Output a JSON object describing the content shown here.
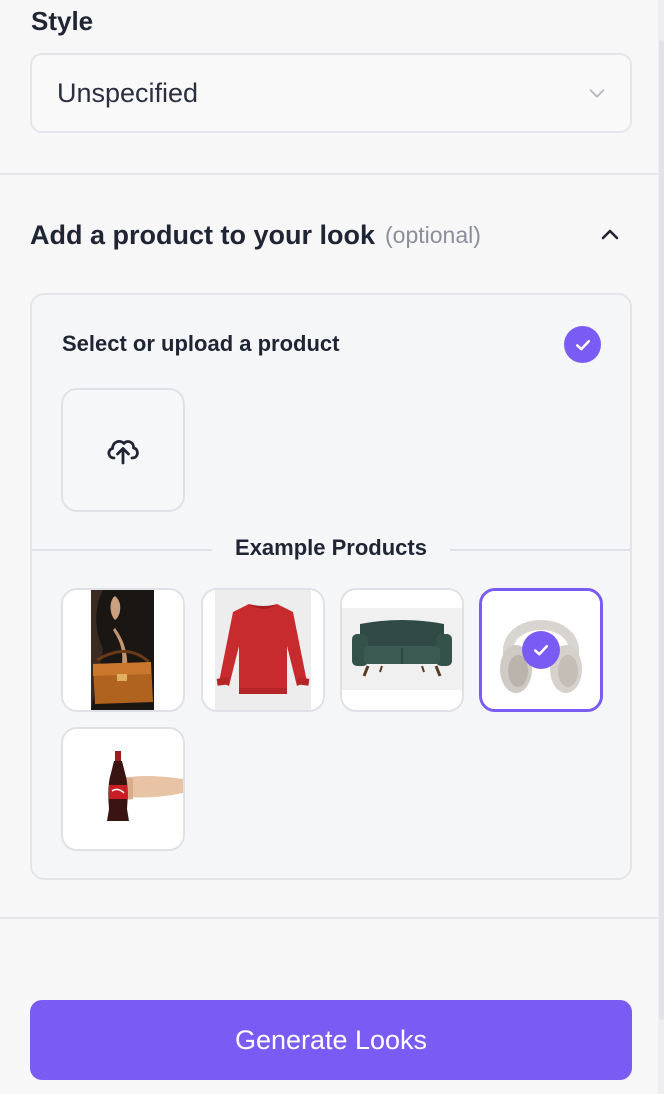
{
  "style": {
    "label": "Style",
    "selected_value": "Unspecified"
  },
  "product_section": {
    "title": "Add a product to your look",
    "optional_label": "(optional)",
    "expanded": true
  },
  "product_card": {
    "title": "Select or upload a product",
    "examples_label": "Example Products",
    "examples": [
      {
        "name": "handbag",
        "selected": false
      },
      {
        "name": "red-sweater",
        "selected": false
      },
      {
        "name": "green-sofa",
        "selected": false
      },
      {
        "name": "headphones",
        "selected": true
      },
      {
        "name": "coca-cola-bottle",
        "selected": false
      }
    ]
  },
  "generate_button": {
    "label": "Generate Looks"
  },
  "colors": {
    "accent": "#7a5cf5",
    "background": "#f7f7f8",
    "text": "#1f2533",
    "muted": "#8a8f9a"
  },
  "icons": [
    "chevron-down-icon",
    "chevron-up-icon",
    "check-icon",
    "upload-cloud-icon"
  ]
}
